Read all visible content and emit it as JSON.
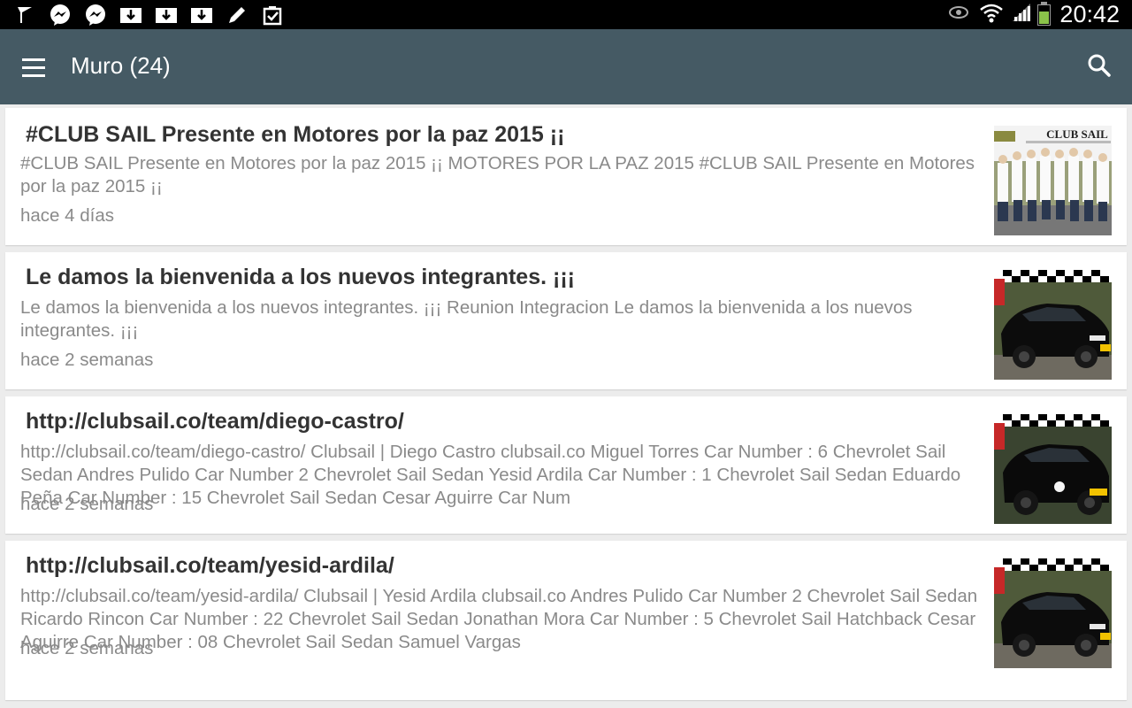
{
  "status_bar": {
    "time": "20:42",
    "left_icons": [
      "navigation-icon",
      "messenger-icon",
      "messenger-icon",
      "download-icon",
      "download-icon",
      "download-icon",
      "edit-icon",
      "clipboard-check-icon"
    ],
    "right_icons": [
      "eye-icon",
      "wifi-icon",
      "signal-icon",
      "battery-icon"
    ]
  },
  "app_bar": {
    "title": "Muro (24)",
    "menu_icon": "menu-icon",
    "search_icon": "search-icon",
    "color": "#455a64"
  },
  "posts": [
    {
      "title": "#CLUB SAIL Presente en Motores por la paz 2015 ¡¡",
      "excerpt": "#CLUB SAIL Presente en Motores por la paz 2015 ¡¡ MOTORES POR LA PAZ 2015 #CLUB SAIL Presente en Motores por la paz 2015 ¡¡",
      "time": "hace 4 días",
      "thumbnail_header": "CLUB SAIL"
    },
    {
      "title": "Le damos la bienvenida a los nuevos integrantes.   ¡¡¡",
      "excerpt": "Le damos la bienvenida a los nuevos integrantes. ¡¡¡ Reunion Integracion Le damos la bienvenida a los nuevos integrantes. ¡¡¡",
      "time": "hace 2 semanas"
    },
    {
      "title": "http://clubsail.co/team/diego-castro/",
      "excerpt": "http://clubsail.co/team/diego-castro/ Clubsail | Diego Castro clubsail.co Miguel Torres Car Number : 6 Chevrolet Sail Sedan Andres Pulido Car Number 2 Chevrolet Sail Sedan Yesid Ardila Car Number : 1 Chevrolet Sail Sedan Eduardo Peña Car Number : 15 Chevrolet Sail Sedan Cesar Aguirre Car Num",
      "time": "hace 2 semanas"
    },
    {
      "title": "http://clubsail.co/team/yesid-ardila/",
      "excerpt": "http://clubsail.co/team/yesid-ardila/ Clubsail | Yesid Ardila clubsail.co Andres Pulido Car Number 2 Chevrolet Sail Sedan Ricardo Rincon Car Number : 22 Chevrolet Sail Sedan Jonathan Mora Car Number : 5 Chevrolet Sail Hatchback Cesar Aguirre Car Number : 08 Chevrolet Sail Sedan Samuel Vargas",
      "time": "hace 2 semanas"
    }
  ]
}
